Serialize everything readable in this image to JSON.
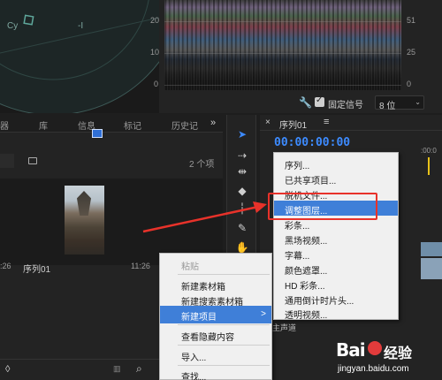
{
  "vectorscope": {
    "labels": [
      "Cy",
      "-I"
    ]
  },
  "waveform": {
    "ticks": [
      "20",
      "10",
      "0"
    ],
    "right_ticks": [
      "51",
      "25",
      "0"
    ],
    "ticks_ire": ""
  },
  "scope_controls": {
    "signal_label": "固定信号",
    "bits_value": "8 位",
    "bits_chevron": "⌄"
  },
  "project_panel": {
    "tabs": [
      "器",
      "库",
      "信息",
      "标记",
      "历史记"
    ],
    "more": "»",
    "item_count": "2 个项",
    "sequence_name": "序列01",
    "duration_left": ":26",
    "duration_right": "11:26"
  },
  "toolbar": {
    "tools": [
      "select-tool",
      "track-select-tool",
      "ripple-edit-tool",
      "razor-tool",
      "slip-tool",
      "pen-tool",
      "hand-tool",
      "type-tool"
    ]
  },
  "timeline": {
    "close": "×",
    "name": "序列01",
    "menu": "≡",
    "timecode": "00:00:00:00",
    "ruler_label": ":00:0",
    "track_label": "主声道"
  },
  "context_menu": {
    "items": [
      {
        "label": "粘贴",
        "disabled": true
      },
      {
        "label": "新建素材箱",
        "disabled": false
      },
      {
        "label": "新建搜索素材箱",
        "disabled": false
      },
      {
        "label": "新建项目",
        "disabled": false,
        "active": true,
        "has_submenu": true
      },
      {
        "label": "查看隐藏内容",
        "disabled": false
      },
      {
        "label": "导入...",
        "disabled": false
      },
      {
        "label": "查找...",
        "disabled": false
      }
    ],
    "submenu_arrow": ">"
  },
  "sub_menu": {
    "items": [
      {
        "label": "序列..."
      },
      {
        "label": "已共享项目..."
      },
      {
        "label": "脱机文件..."
      },
      {
        "label": "调整图层...",
        "active": true
      },
      {
        "label": "彩条..."
      },
      {
        "label": "黑场视频..."
      },
      {
        "label": "字幕..."
      },
      {
        "label": "颜色遮罩..."
      },
      {
        "label": "HD 彩条..."
      },
      {
        "label": "通用倒计时片头..."
      },
      {
        "label": "透明视频..."
      }
    ]
  },
  "colors": {
    "accent": "#3d8bff",
    "highlight": "#e8322a",
    "menu_active": "#3f7fd8"
  },
  "watermark": {
    "logo": "Bai",
    "brand": "经验",
    "url": "jingyan.baidu.com"
  }
}
